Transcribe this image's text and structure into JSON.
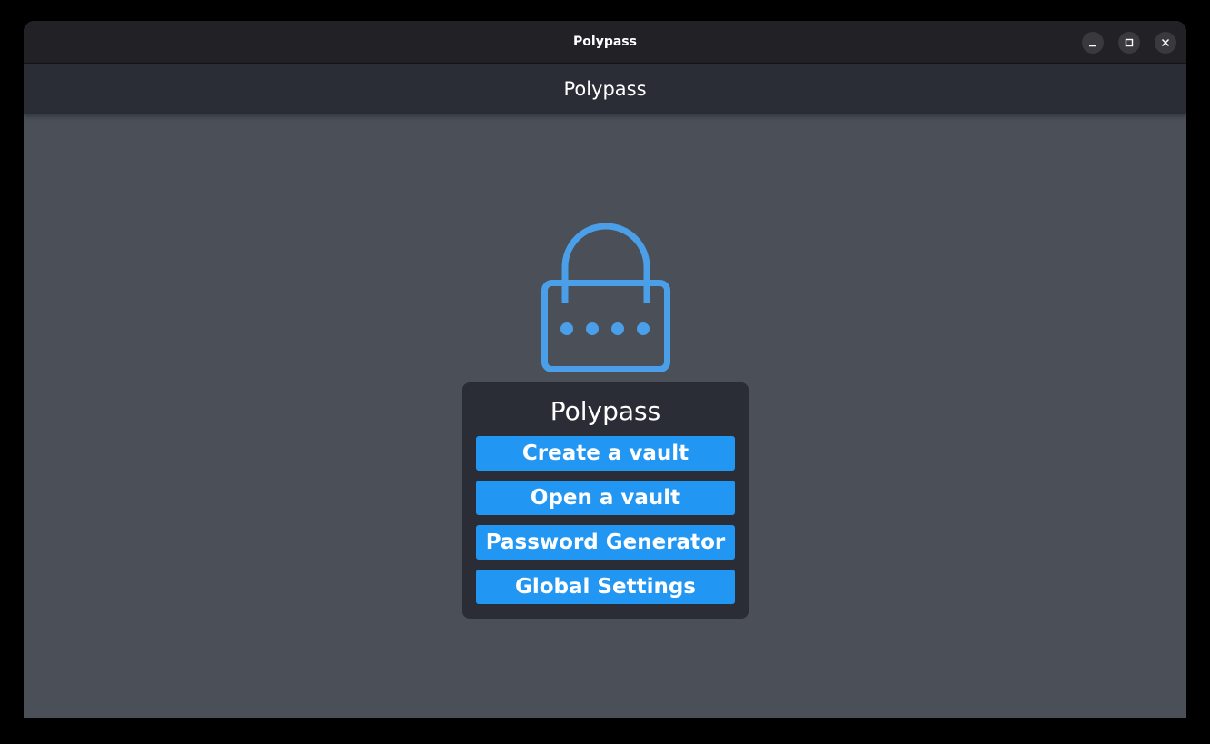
{
  "window": {
    "title": "Polypass",
    "controls": {
      "minimize_icon": "minimize-icon",
      "maximize_icon": "maximize-icon",
      "close_icon": "close-icon"
    }
  },
  "appbar": {
    "title": "Polypass"
  },
  "hero": {
    "icon": "lock-icon",
    "color": "#4a9fe8"
  },
  "card": {
    "title": "Polypass",
    "buttons": [
      {
        "label": "Create a vault"
      },
      {
        "label": "Open a vault"
      },
      {
        "label": "Password Generator"
      },
      {
        "label": "Global Settings"
      }
    ]
  },
  "colors": {
    "accent": "#2196f3",
    "background": "#4b4f57",
    "surface": "#2a2d35",
    "titlebar": "#222226"
  }
}
